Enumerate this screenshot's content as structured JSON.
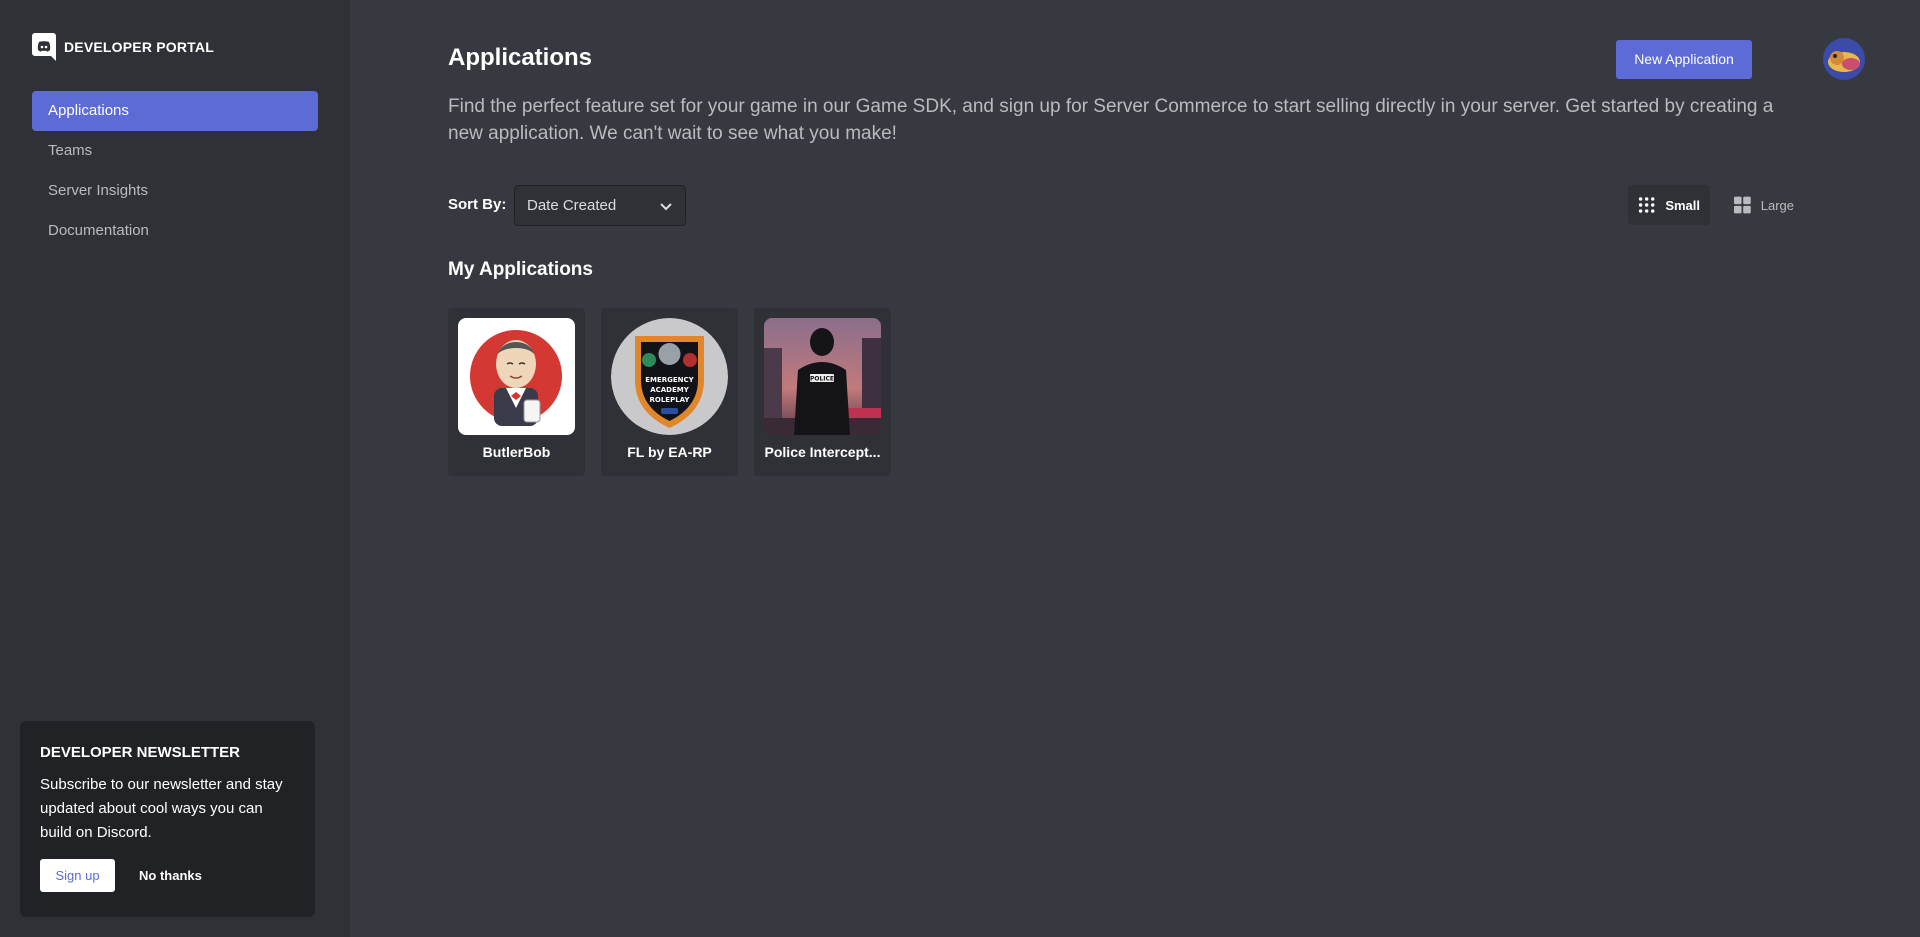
{
  "brand": {
    "logo_icon": "discord-logo-icon",
    "title": "DEVELOPER PORTAL"
  },
  "sidebar": {
    "items": [
      {
        "label": "Applications",
        "active": true
      },
      {
        "label": "Teams",
        "active": false
      },
      {
        "label": "Server Insights",
        "active": false
      },
      {
        "label": "Documentation",
        "active": false
      }
    ]
  },
  "newsletter": {
    "title": "DEVELOPER NEWSLETTER",
    "body": "Subscribe to our newsletter and stay updated about cool ways you can build on Discord.",
    "signup_label": "Sign up",
    "dismiss_label": "No thanks"
  },
  "header": {
    "title": "Applications",
    "new_app_label": "New Application",
    "intro": "Find the perfect feature set for your game in our Game SDK, and sign up for Server Commerce to start selling directly in your server. Get started by creating a new application. We can't wait to see what you make!"
  },
  "sort": {
    "label": "Sort By:",
    "value": "Date Created"
  },
  "view": {
    "small_label": "Small",
    "large_label": "Large",
    "selected": "Small"
  },
  "applications": {
    "section_title": "My Applications",
    "items": [
      {
        "name": "ButlerBob",
        "icon": "butler-avatar-icon"
      },
      {
        "name": "FL by EA-RP",
        "icon": "police-badge-icon"
      },
      {
        "name": "Police Intercept...",
        "icon": "police-officer-photo-icon"
      }
    ]
  },
  "colors": {
    "background": "#36393f",
    "sidebar": "#2f3136",
    "accent": "#5c6bd6",
    "card": "#2f3136",
    "muted_text": "#b9bbbe"
  }
}
